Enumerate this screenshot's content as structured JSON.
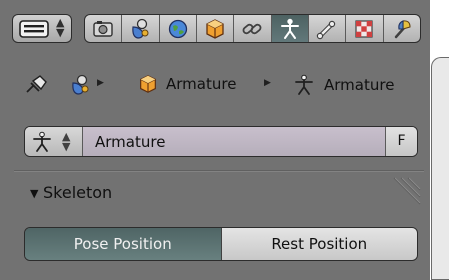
{
  "toolbar": {
    "editor_type_icon": "properties-editor-icon",
    "context_tabs": [
      {
        "icon": "render-icon",
        "active": false
      },
      {
        "icon": "scene-icon",
        "active": false
      },
      {
        "icon": "world-icon",
        "active": false
      },
      {
        "icon": "object-icon",
        "active": false
      },
      {
        "icon": "constraints-icon",
        "active": false
      },
      {
        "icon": "armature-data-icon",
        "active": true
      },
      {
        "icon": "bone-icon",
        "active": false
      },
      {
        "icon": "material-icon",
        "active": false
      },
      {
        "icon": "texture-icon",
        "active": false
      }
    ]
  },
  "breadcrumb": {
    "items": [
      {
        "icon": "pin-icon"
      },
      {
        "icon": "scene-icon"
      },
      {
        "icon": "object-icon",
        "label": "Armature"
      },
      {
        "icon": "armature-data-icon",
        "label": "Armature"
      }
    ]
  },
  "datablock": {
    "icon": "armature-data-icon",
    "name": "Armature",
    "fake_user_label": "F"
  },
  "skeleton_panel": {
    "title": "Skeleton",
    "expanded": true,
    "position_options": [
      {
        "label": "Pose Position",
        "active": true
      },
      {
        "label": "Rest Position",
        "active": false
      }
    ]
  },
  "colors": {
    "background": "#727272",
    "active_toggle": "#5b7171",
    "datablock_field": "#c0b8c5"
  }
}
